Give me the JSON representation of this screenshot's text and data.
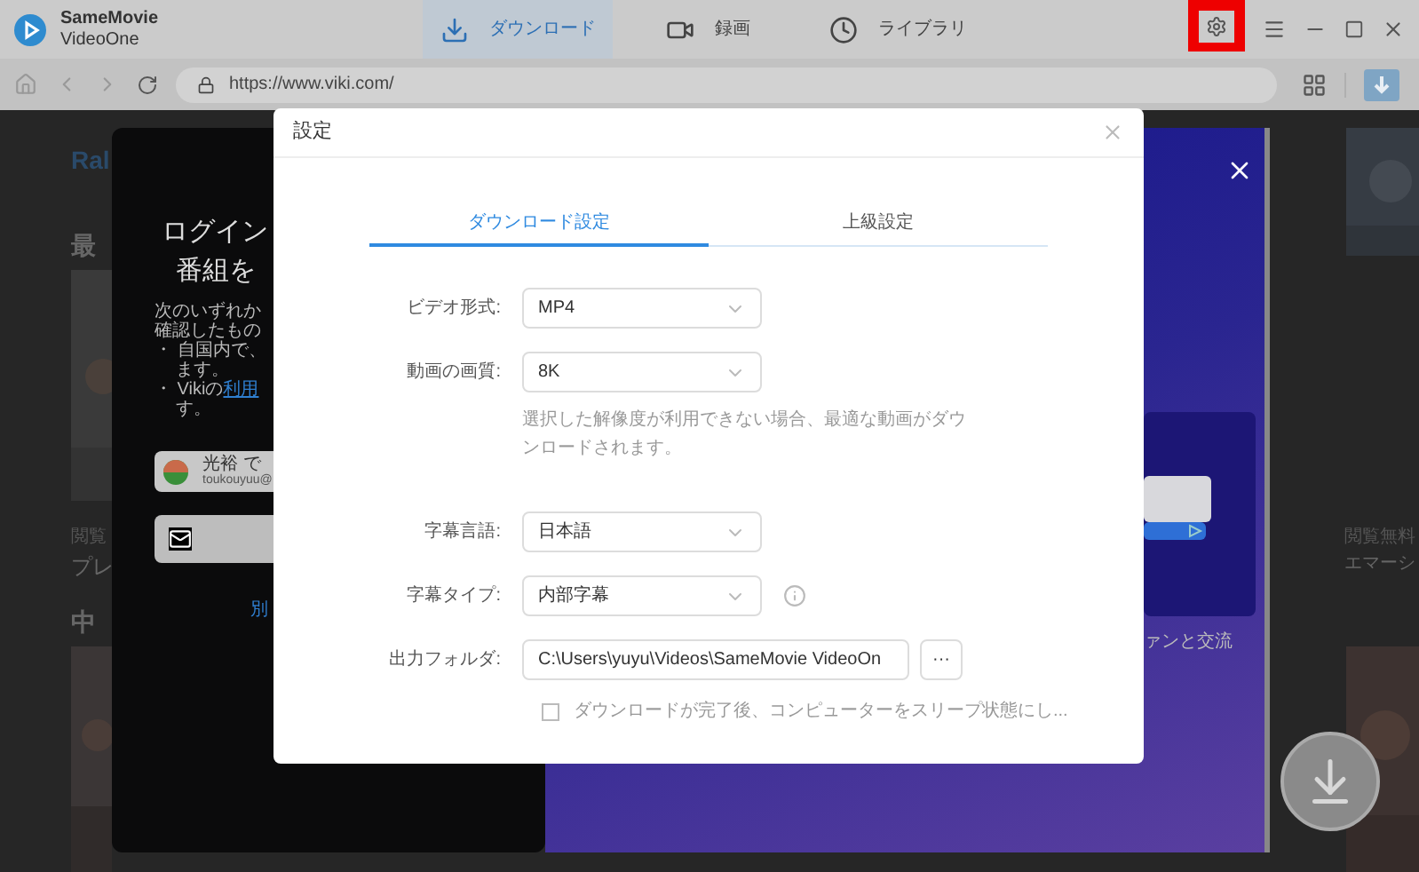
{
  "app": {
    "name": "SameMovie",
    "subtitle": "VideoOne"
  },
  "nav_tabs": [
    {
      "label": "ダウンロード",
      "kind": "download",
      "selected": true
    },
    {
      "label": "録画",
      "kind": "record",
      "selected": false
    },
    {
      "label": "ライブラリ",
      "kind": "library",
      "selected": false
    }
  ],
  "address_bar": {
    "url": "https://www.viki.com/"
  },
  "background_page": {
    "logo": "Ral",
    "sections": [
      "最",
      "中"
    ],
    "cards": [
      {
        "tag": "閲覧",
        "title": "プレ"
      },
      {
        "tag": "閲覧無料",
        "title": "エマーシ"
      }
    ]
  },
  "login_modal": {
    "heading": [
      "ログイン",
      "番組を"
    ],
    "intro": [
      "次のいずれか",
      "確認したもの"
    ],
    "bullets": [
      [
        "・ 自国内で、",
        "ます。"
      ],
      [
        "・ Vikiの",
        "利用",
        "す。"
      ]
    ],
    "google_button": {
      "name": "光裕 で",
      "email": "toukouyuu@"
    },
    "other_link": "別",
    "promo_caption": "ァンと交流"
  },
  "settings_dialog": {
    "title": "設定",
    "tabs": [
      {
        "label": "ダウンロード設定",
        "selected": true
      },
      {
        "label": "上級設定",
        "selected": false
      }
    ],
    "fields": [
      {
        "kind": "select",
        "label": "ビデオ形式:",
        "value": "MP4"
      },
      {
        "kind": "select",
        "label": "動画の画質:",
        "value": "8K",
        "hint": "選択した解像度が利用できない場合、最適な動画がダウンロードされます。"
      },
      {
        "kind": "select",
        "label": "字幕言語:",
        "value": "日本語"
      },
      {
        "kind": "select",
        "label": "字幕タイプ:",
        "value": "内部字幕",
        "info": true
      },
      {
        "kind": "path",
        "label": "出力フォルダ:",
        "value": "C:\\Users\\yuyu\\Videos\\SameMovie VideoOn",
        "button": "···"
      }
    ],
    "sleep_option": {
      "label": "ダウンロードが完了後、コンピューターをスリープ状態にし...",
      "checked": false
    }
  }
}
